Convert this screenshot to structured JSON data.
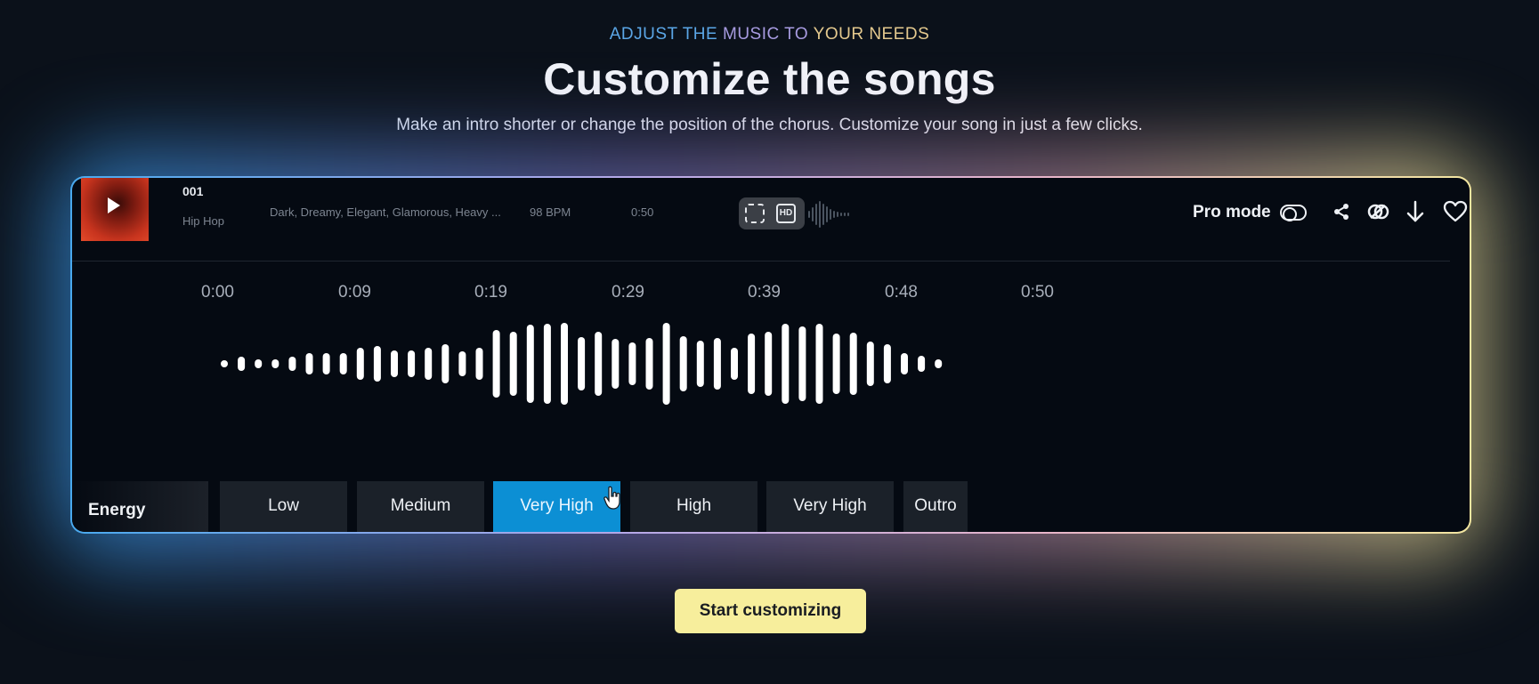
{
  "eyebrow": {
    "part1": "ADJUST THE",
    "part2": "MUSIC TO",
    "part3": "YOUR NEEDS"
  },
  "headline": "Customize the songs",
  "subhead": "Make an intro shorter or change the position of the chorus. Customize your song in just a few clicks.",
  "player": {
    "track_number": "001",
    "genre": "Hip Hop",
    "tags": "Dark, Dreamy, Elegant, Glamorous, Heavy ...",
    "bpm": "98 BPM",
    "duration": "0:50",
    "pro_mode_label": "Pro mode",
    "icons": [
      "play-icon",
      "swap-icon",
      "hd-icon",
      "toggle-icon",
      "share-icon",
      "link-icon",
      "download-icon",
      "heart-icon"
    ]
  },
  "timeline": {
    "times": [
      "0:00",
      "0:09",
      "0:19",
      "0:29",
      "0:39",
      "0:48",
      "0:50"
    ]
  },
  "energy": {
    "label": "Energy",
    "segments": [
      {
        "label": "Low",
        "active": false
      },
      {
        "label": "Medium",
        "active": false
      },
      {
        "label": "Very High",
        "active": true
      },
      {
        "label": "High",
        "active": false
      },
      {
        "label": "Very High",
        "active": false
      },
      {
        "label": "Outro",
        "active": false
      }
    ]
  },
  "cta": {
    "label": "Start customizing"
  },
  "colors": {
    "accent_blue": "#0c8fd4",
    "cta_yellow": "#f7ee9c",
    "background": "#0b111a"
  }
}
